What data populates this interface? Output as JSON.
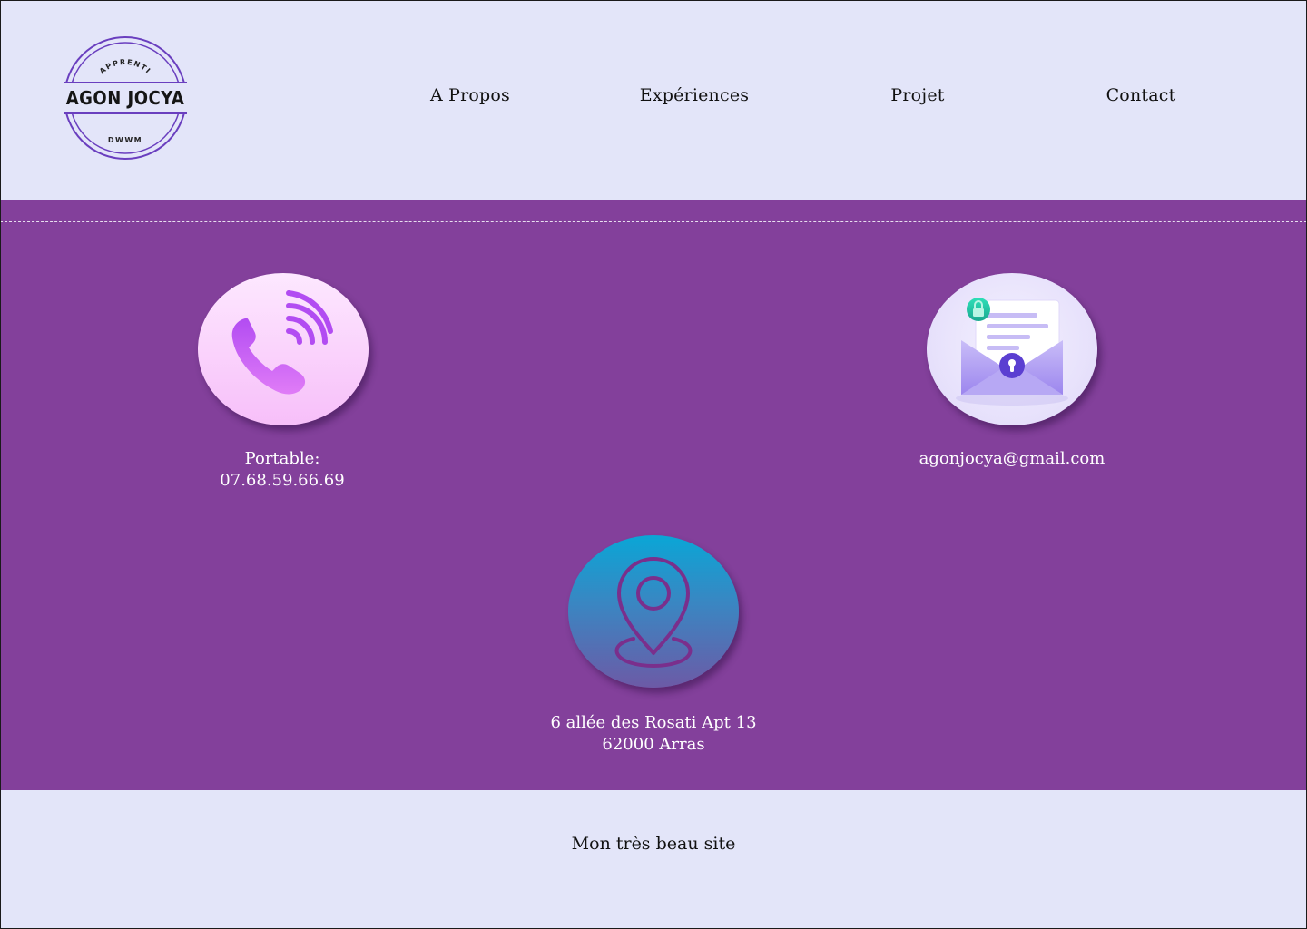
{
  "header": {
    "logo": {
      "top_text": "APPRENTI",
      "name": "AGON JOCYA",
      "bottom_text": "DWWM",
      "color": "#6a3fbf"
    },
    "nav": [
      {
        "label": "A Propos"
      },
      {
        "label": "Expériences"
      },
      {
        "label": "Projet"
      },
      {
        "label": "Contact"
      }
    ]
  },
  "contact": {
    "phone": {
      "icon": "phone-ringing-icon",
      "label": "Portable:",
      "value": "07.68.59.66.69"
    },
    "email": {
      "icon": "secure-envelope-icon",
      "value": "agonjocya@gmail.com"
    },
    "address": {
      "icon": "location-pin-icon",
      "line1": "6 allée des Rosati Apt 13",
      "line2": "62000 Arras"
    }
  },
  "footer": {
    "text": "Mon très beau site"
  },
  "colors": {
    "page_background": "#e3e5f9",
    "main_background": "#83409b",
    "accent": "#b44df0"
  }
}
